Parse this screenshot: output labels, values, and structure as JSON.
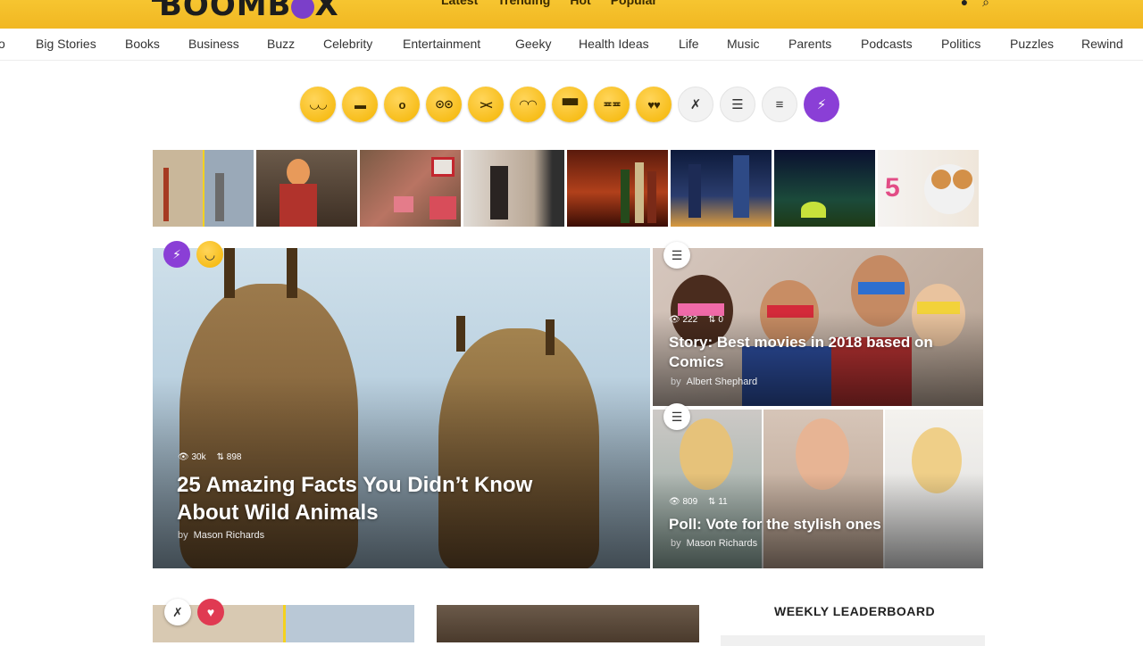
{
  "header": {
    "logo_text": "BOOMB",
    "logo_tail": "X",
    "nav": [
      "Latest",
      "Trending",
      "Hot",
      "Popular"
    ]
  },
  "categories": [
    "o",
    "Big Stories",
    "Books",
    "Business",
    "Buzz",
    "Celebrity",
    "Entertainment",
    "Geeky",
    "Health Ideas",
    "Life",
    "Music",
    "Parents",
    "Podcasts",
    "Politics",
    "Puzzles",
    "Rewind"
  ],
  "reactions": [
    {
      "icon": "laughing-emoji-icon",
      "glyph": "😂"
    },
    {
      "icon": "grimacing-emoji-icon",
      "glyph": "😬"
    },
    {
      "icon": "surprised-emoji-icon",
      "glyph": "😮"
    },
    {
      "icon": "nerd-emoji-icon",
      "glyph": "🤓"
    },
    {
      "icon": "angry-emoji-icon",
      "glyph": "😠"
    },
    {
      "icon": "shy-emoji-icon",
      "glyph": "😊"
    },
    {
      "icon": "cool-emoji-icon",
      "glyph": "😎"
    },
    {
      "icon": "confused-emoji-icon",
      "glyph": "😖"
    },
    {
      "icon": "love-emoji-icon",
      "glyph": "😍"
    },
    {
      "icon": "fail-icon",
      "glyph": "✗"
    },
    {
      "icon": "ranked-list-icon",
      "glyph": "☰"
    },
    {
      "icon": "list-icon",
      "glyph": "≡"
    },
    {
      "icon": "trending-bolt-icon",
      "glyph": "⚡"
    }
  ],
  "thumbnails": [
    {
      "name": "bridges",
      "bg": "linear-gradient(90deg,#c9b79a 0 50%,#9aa9b8 50%)"
    },
    {
      "name": "headphones-girl",
      "bg": "linear-gradient(#6b5a4a,#3d2f24)"
    },
    {
      "name": "gifts",
      "bg": "linear-gradient(135deg,#7a5a44,#b97463,#6f503d)"
    },
    {
      "name": "bedroom",
      "bg": "linear-gradient(90deg,#d8d2ca,#b9a99a,#3a3a3a)"
    },
    {
      "name": "bottles",
      "bg": "linear-gradient(#5a1a0c,#b1401b,#3a0d05)"
    },
    {
      "name": "city-night",
      "bg": "linear-gradient(#0d1a3a,#2b3d6e,#e0a34a)"
    },
    {
      "name": "aurora",
      "bg": "linear-gradient(#0a1030,#1b4a3a,#7ed04a)"
    },
    {
      "name": "breakfast",
      "bg": "linear-gradient(90deg,#f4f1ee,#efe3d4)"
    }
  ],
  "breakfast_label": "5",
  "featured": {
    "views": "30k",
    "votes": "898",
    "title": "25 Amazing Facts You Didn’t Know About Wild Animals",
    "by_prefix": "by",
    "author": "Mason Richards"
  },
  "card1": {
    "views": "222",
    "votes": "0",
    "title": "Story: Best movies in 2018 based on Comics",
    "by_prefix": "by",
    "author": "Albert Shephard"
  },
  "card2": {
    "views": "809",
    "votes": "11",
    "title": "Poll: Vote for the stylish ones",
    "by_prefix": "by",
    "author": "Mason Richards"
  },
  "sidebar": {
    "leaderboard_title": "WEEKLY LEADERBOARD"
  },
  "colors": {
    "brand_yellow": "#f4bf2a",
    "accent_purple": "#8a3fd6",
    "heart_red": "#e03a52"
  }
}
